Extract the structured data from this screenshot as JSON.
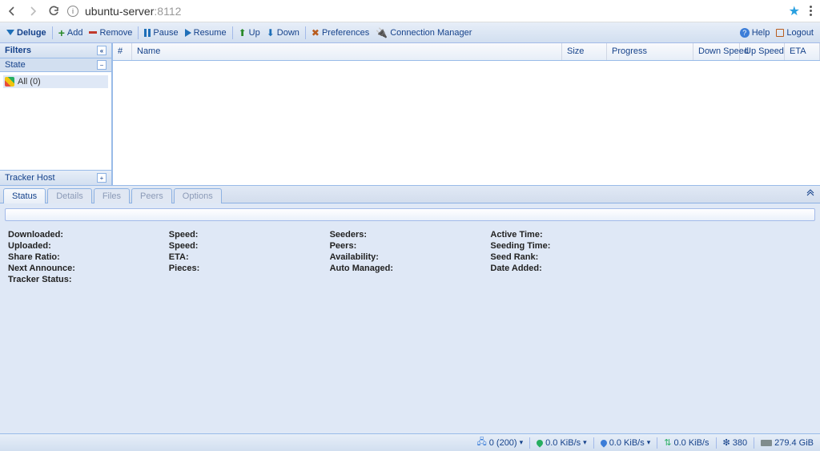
{
  "browser": {
    "host": "ubuntu-server",
    "port": ":8112"
  },
  "toolbar": {
    "brand": "Deluge",
    "add": "Add",
    "remove": "Remove",
    "pause": "Pause",
    "resume": "Resume",
    "up": "Up",
    "down": "Down",
    "preferences": "Preferences",
    "connmgr": "Connection Manager",
    "help": "Help",
    "logout": "Logout"
  },
  "sidebar": {
    "filters_title": "Filters",
    "state_title": "State",
    "all_label": "All (0)",
    "tracker_title": "Tracker Host"
  },
  "grid": {
    "cols": {
      "num": "#",
      "name": "Name",
      "size": "Size",
      "progress": "Progress",
      "down_speed": "Down Speed",
      "up_speed": "Up Speed",
      "eta": "ETA"
    }
  },
  "tabs": {
    "status": "Status",
    "details": "Details",
    "files": "Files",
    "peers": "Peers",
    "options": "Options"
  },
  "status": {
    "col1": {
      "downloaded": "Downloaded:",
      "uploaded": "Uploaded:",
      "share_ratio": "Share Ratio:",
      "next_announce": "Next Announce:",
      "tracker_status": "Tracker Status:"
    },
    "col2": {
      "speed1": "Speed:",
      "speed2": "Speed:",
      "eta": "ETA:",
      "pieces": "Pieces:"
    },
    "col3": {
      "seeders": "Seeders:",
      "peers": "Peers:",
      "availability": "Availability:",
      "auto_managed": "Auto Managed:"
    },
    "col4": {
      "active_time": "Active Time:",
      "seeding_time": "Seeding Time:",
      "seed_rank": "Seed Rank:",
      "date_added": "Date Added:"
    }
  },
  "statusbar": {
    "connections": "0 (200)",
    "down": "0.0 KiB/s",
    "up": "0.0 KiB/s",
    "protocol": "0.0 KiB/s",
    "dht": "380",
    "disk": "279.4 GiB"
  }
}
